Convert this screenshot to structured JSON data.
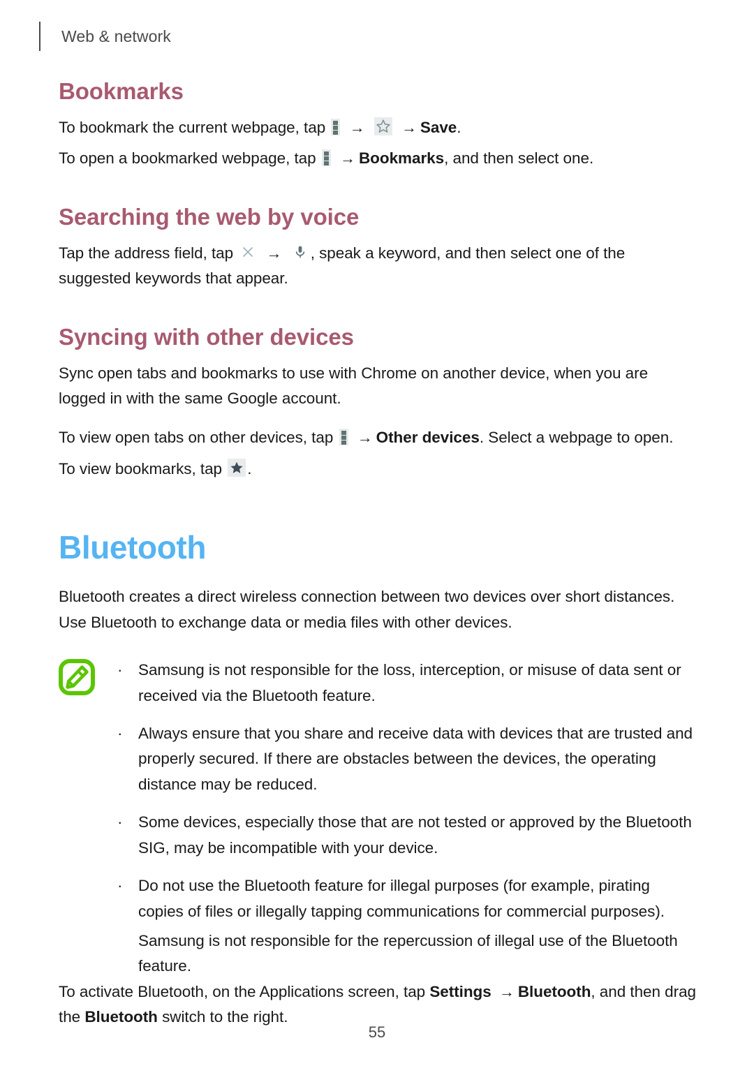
{
  "header": {
    "title": "Web & network"
  },
  "sections": {
    "bookmarks": {
      "heading": "Bookmarks",
      "line1_pre": "To bookmark the current webpage, tap",
      "line1_mid": "",
      "line1_bold": "Save",
      "line1_end": ".",
      "line2_pre": "To open a bookmarked webpage, tap",
      "line2_bold": "Bookmarks",
      "line2_end": ", and then select one."
    },
    "voice": {
      "heading": "Searching the web by voice",
      "line1_pre": "Tap the address field, tap",
      "line1_post": ", speak a keyword, and then select one of the suggested keywords that appear."
    },
    "syncing": {
      "heading": "Syncing with other devices",
      "para1": "Sync open tabs and bookmarks to use with Chrome on another device, when you are logged in with the same Google account.",
      "line2_pre": "To view open tabs on other devices, tap",
      "line2_bold": "Other devices",
      "line2_end": ". Select a webpage to open.",
      "line3_pre": "To view bookmarks, tap",
      "line3_end": "."
    },
    "bluetooth": {
      "heading": "Bluetooth",
      "intro": "Bluetooth creates a direct wireless connection between two devices over short distances. Use Bluetooth to exchange data or media files with other devices.",
      "note_bullets": [
        "Samsung is not responsible for the loss, interception, or misuse of data sent or received via the Bluetooth feature.",
        "Always ensure that you share and receive data with devices that are trusted and properly secured. If there are obstacles between the devices, the operating distance may be reduced.",
        "Some devices, especially those that are not tested or approved by the Bluetooth SIG, may be incompatible with your device.",
        "Do not use the Bluetooth feature for illegal purposes (for example, pirating copies of files or illegally tapping communications for commercial purposes)."
      ],
      "note_sub_paragraph": "Samsung is not responsible for the repercussion of illegal use of the Bluetooth feature.",
      "closing_pre": "To activate Bluetooth, on the Applications screen, tap",
      "closing_bold1": "Settings",
      "closing_bold2": "Bluetooth",
      "closing_mid": ", and then drag the",
      "closing_bold3": "Bluetooth",
      "closing_end": "switch to the right."
    }
  },
  "icons": {
    "menu": "more-options-icon",
    "star_outline": "star-outline-icon",
    "star_filled": "star-filled-icon",
    "close": "close-icon",
    "microphone": "microphone-icon",
    "note": "note-pencil-icon",
    "arrow": "→",
    "bullet": "·"
  },
  "footer": {
    "page_number": "55"
  },
  "colors": {
    "section_heading": "#a85a70",
    "chapter_heading": "#55b4f2",
    "note_icon": "#5bc500",
    "icon_glyph": "#607273",
    "icon_chip_bg": "#e9ebec",
    "body_text": "#1a1a1a",
    "header_text": "#4a4a4a"
  }
}
